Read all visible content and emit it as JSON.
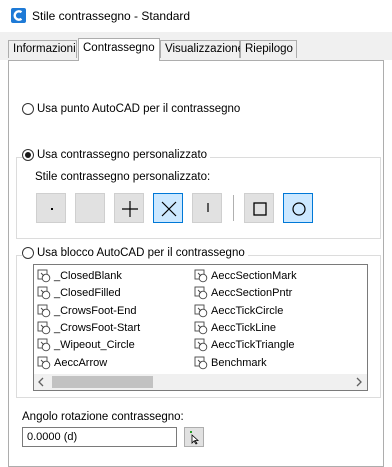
{
  "window": {
    "title": "Stile contrassegno - Standard"
  },
  "tabs": [
    {
      "label": "Informazioni",
      "active": false
    },
    {
      "label": "Contrassegno",
      "active": true
    },
    {
      "label": "Visualizzazione",
      "active": false
    },
    {
      "label": "Riepilogo",
      "active": false
    }
  ],
  "options": {
    "use_autocad_point": "Usa punto AutoCAD per il contrassegno",
    "use_custom": "Usa contrassegno personalizzato",
    "custom_style_label": "Stile contrassegno personalizzato:",
    "use_autocad_block": "Usa blocco AutoCAD per il contrassegno"
  },
  "selected_option": "use_custom",
  "style_buttons": [
    {
      "name": "dot",
      "selected": false
    },
    {
      "name": "none",
      "selected": false
    },
    {
      "name": "plus",
      "selected": false
    },
    {
      "name": "x",
      "selected": true
    },
    {
      "name": "tick",
      "selected": false
    },
    {
      "name": "square",
      "selected": false
    },
    {
      "name": "circle",
      "selected": true
    }
  ],
  "blocks_col1": [
    "_ClosedBlank",
    "_ClosedFilled",
    "_CrowsFoot-End",
    "_CrowsFoot-Start",
    "_Wipeout_Circle",
    "AeccArrow"
  ],
  "blocks_col2": [
    "AeccSectionMark",
    "AeccSectionPntr",
    "AeccTickCircle",
    "AeccTickLine",
    "AeccTickTriangle",
    "Benchmark"
  ],
  "rotation": {
    "label": "Angolo rotazione contrassegno:",
    "value": "0.0000 (d)"
  },
  "colors": {
    "accent": "#0078d7",
    "selected_bg": "#cce8ff",
    "app_icon": "#1e7ad6"
  }
}
